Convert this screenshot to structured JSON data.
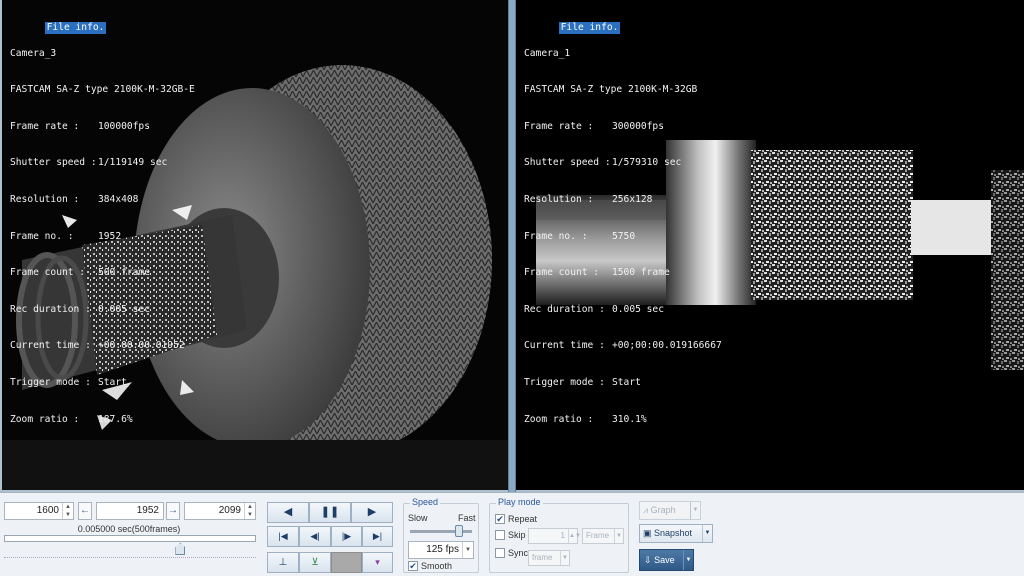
{
  "left_pane": {
    "header": "File info.",
    "camera": "Camera_3",
    "model": "FASTCAM SA-Z type 2100K-M-32GB-E",
    "fields": [
      {
        "label": "Frame rate :",
        "value": "100000fps"
      },
      {
        "label": "Shutter speed :",
        "value": "1/119149 sec"
      },
      {
        "label": "Resolution :",
        "value": "384x408"
      },
      {
        "label": "Frame no. :",
        "value": "1952"
      },
      {
        "label": "Frame count :",
        "value": "500 frame"
      },
      {
        "label": "Rec duration :",
        "value": "0.005 sec"
      },
      {
        "label": "Current time :",
        "value": "+00:00:00.01952"
      },
      {
        "label": "Trigger mode :",
        "value": "Start"
      },
      {
        "label": "Zoom ratio :",
        "value": "187.6%"
      }
    ]
  },
  "right_pane": {
    "header": "File info.",
    "camera": "Camera_1",
    "model": "FASTCAM SA-Z type 2100K-M-32GB",
    "fields": [
      {
        "label": "Frame rate :",
        "value": "300000fps"
      },
      {
        "label": "Shutter speed :",
        "value": "1/579310 sec"
      },
      {
        "label": "Resolution :",
        "value": "256x128"
      },
      {
        "label": "Frame no. :",
        "value": "5750"
      },
      {
        "label": "Frame count :",
        "value": "1500 frame"
      },
      {
        "label": "Rec duration :",
        "value": "0.005 sec"
      },
      {
        "label": "Current time :",
        "value": "+00;00:00.019166667"
      },
      {
        "label": "Trigger mode :",
        "value": "Start"
      },
      {
        "label": "Zoom ratio :",
        "value": "310.1%"
      }
    ]
  },
  "frame_controls": {
    "start_frame": "1600",
    "current_frame": "1952",
    "end_frame": "2099",
    "duration": "0.005000 sec(500frames)",
    "slider_position": 0.7
  },
  "playback": {
    "rewind": "◀",
    "pause": "❚❚",
    "play": "▶",
    "first": "|◀",
    "step_back": "◀|",
    "step_forward": "|▶",
    "last": "▶|"
  },
  "speed": {
    "title": "Speed",
    "slow": "Slow",
    "fast": "Fast",
    "fps": "125 fps",
    "smooth": "Smooth",
    "smooth_checked": true
  },
  "play_mode": {
    "title": "Play mode",
    "repeat": "Repeat",
    "repeat_checked": true,
    "skip": "Skip",
    "skip_value": "1",
    "skip_unit": "Frame",
    "sync": "Sync",
    "sync_unit": "frame"
  },
  "actions": {
    "graph": "Graph",
    "snapshot": "Snapshot",
    "save": "Save"
  },
  "colors": {
    "header_bg": "#2a6fc0",
    "accent": "#2f5a87"
  }
}
